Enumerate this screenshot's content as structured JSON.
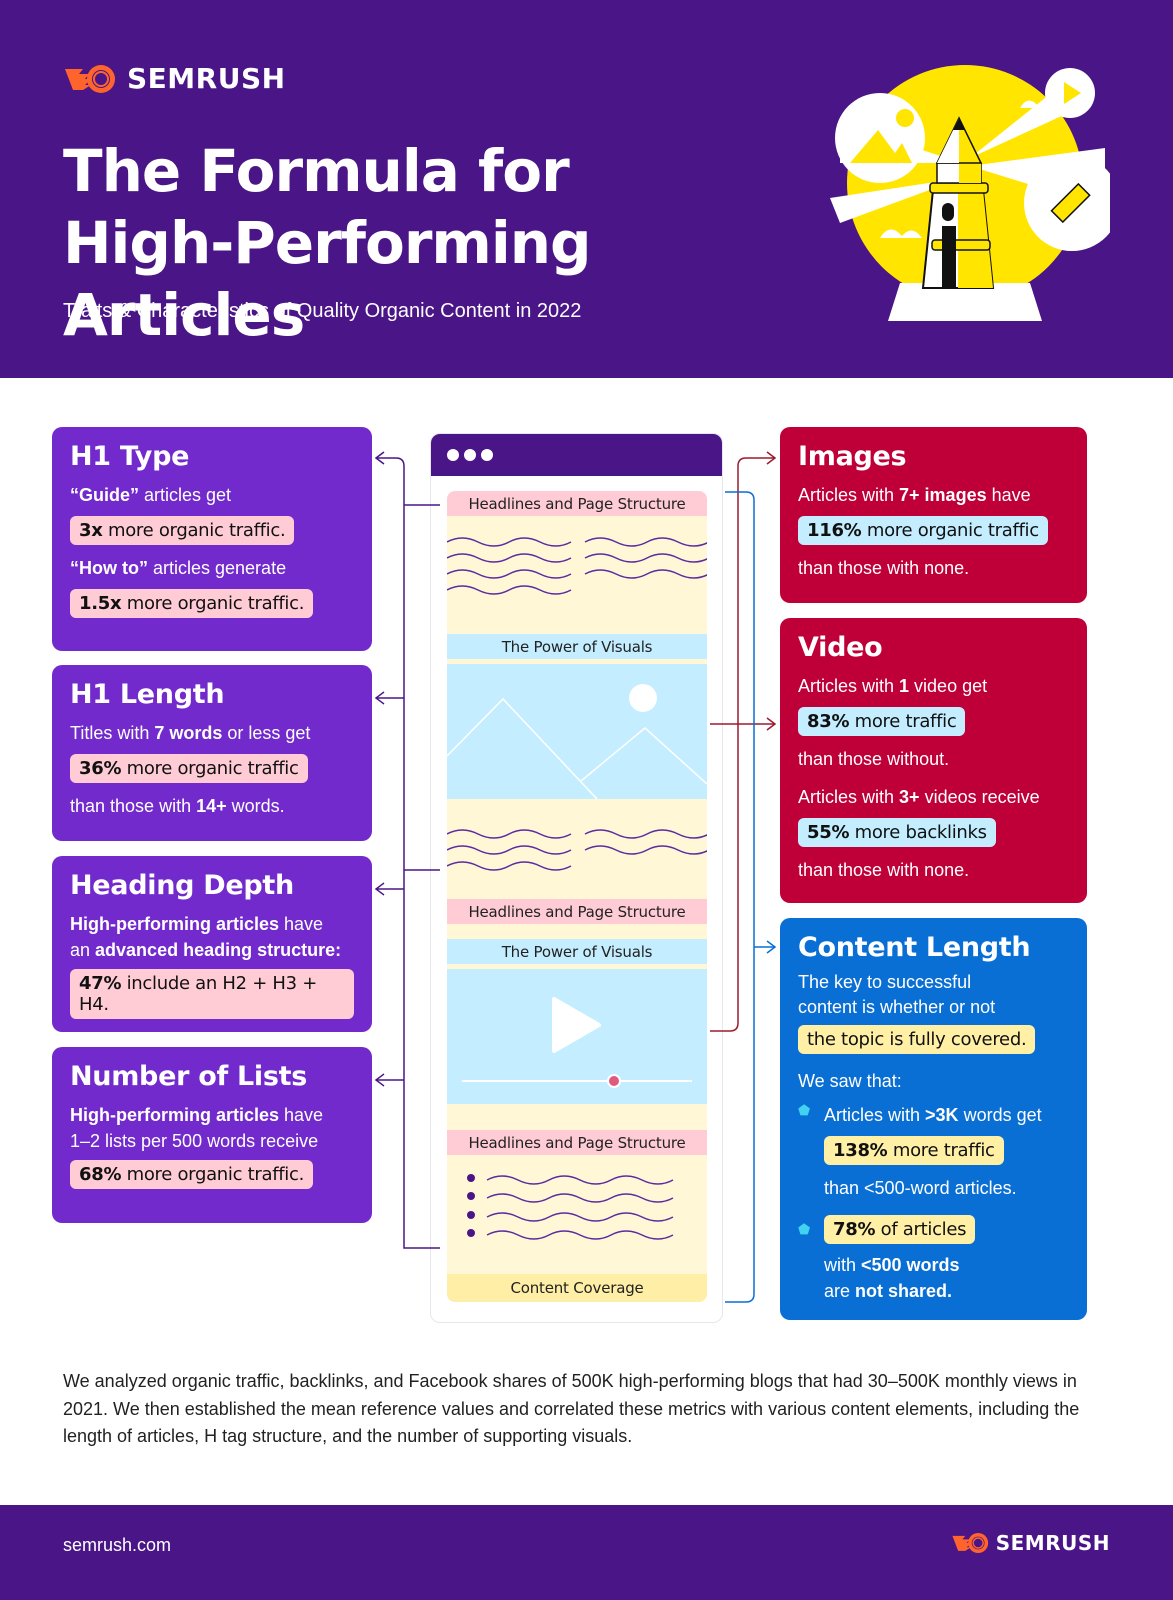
{
  "header": {
    "brand": "SEMRUSH",
    "title": "The Formula for High-Performing Articles",
    "subtitle": "Traits & Characteristics of Quality Organic Content in 2022",
    "illustration": "lighthouse-illustration"
  },
  "colors": {
    "brand_purple": "#4a1586",
    "card_purple": "#722acd",
    "card_red": "#bf0038",
    "card_blue": "#0a6fd4",
    "logo_orange": "#ff642d",
    "highlight_pink": "#ffccd6",
    "highlight_blue": "#c4eeff",
    "highlight_yellow": "#fff0a6"
  },
  "left_cards": [
    {
      "title": "H1 Type",
      "lines": [
        {
          "bold": "“Guide”",
          "text": " articles get"
        },
        {
          "pill_bold": "3x",
          "pill_text": " more organic traffic."
        },
        {
          "bold": "“How to”",
          "text": " articles generate"
        },
        {
          "pill_bold": "1.5x",
          "pill_text": " more organic traffic."
        }
      ]
    },
    {
      "title": "H1 Length",
      "line1_pre": "Titles with ",
      "line1_bold": "7 words",
      "line1_post": " or less get",
      "pill_bold": "36%",
      "pill_text": " more organic traffic",
      "line3_pre": "than those with ",
      "line3_bold": "14+",
      "line3_post": " words."
    },
    {
      "title": "Heading Depth",
      "line1_bold": "High-performing articles",
      "line1_post": " have",
      "line2_pre": "an ",
      "line2_bold": "advanced heading structure:",
      "pill_bold": "47%",
      "pill_text": " include an H2 + H3 + H4."
    },
    {
      "title": "Number of Lists",
      "line1_bold": "High-performing articles",
      "line1_post": " have",
      "line2": "1–2 lists per 500 words receive",
      "pill_bold": "68%",
      "pill_text": " more organic traffic."
    }
  ],
  "right_cards": {
    "images": {
      "title": "Images",
      "line1_pre": "Articles with ",
      "line1_bold": "7+ images",
      "line1_post": " have",
      "pill_bold": "116%",
      "pill_text": " more organic traffic",
      "line3": "than those with none."
    },
    "video": {
      "title": "Video",
      "line1_pre": "Articles with ",
      "line1_bold": "1",
      "line1_post": " video get",
      "pill1_bold": "83%",
      "pill1_text": " more traffic",
      "line3": "than those without.",
      "line4_pre": "Articles with ",
      "line4_bold": "3+",
      "line4_post": " videos receive",
      "pill2_bold": "55%",
      "pill2_text": " more backlinks",
      "line6": "than those with none."
    },
    "content_length": {
      "title": "Content Length",
      "line1": "The key to successful",
      "line2": "content is whether or not",
      "pill": "the topic is fully covered.",
      "intro": "We saw that:",
      "bullet1_pre": "Articles with ",
      "bullet1_bold": ">3K",
      "bullet1_post": " words get",
      "bullet1_pill_bold": "138%",
      "bullet1_pill_text": " more traffic",
      "bullet1_after": "than <500-word articles.",
      "bullet2_pill_bold": "78%",
      "bullet2_pill_text": " of articles",
      "bullet2_l1_pre": "with ",
      "bullet2_l1_bold": "<500 words",
      "bullet2_l2_pre": "are ",
      "bullet2_l2_bold": "not shared."
    }
  },
  "browser_mock": {
    "bands": {
      "headlines": "Headlines and Page Structure",
      "visuals": "The Power of Visuals",
      "coverage": "Content Coverage"
    },
    "video_progress": 0.66
  },
  "footnote": "We analyzed organic traffic, backlinks, and Facebook shares of 500K high-performing blogs that had 30–500K monthly views in 2021. We then established the mean reference values and correlated these metrics with various content elements, including the length of articles, H tag structure, and the number of supporting visuals.",
  "footer": {
    "url": "semrush.com",
    "brand": "SEMRUSH"
  }
}
